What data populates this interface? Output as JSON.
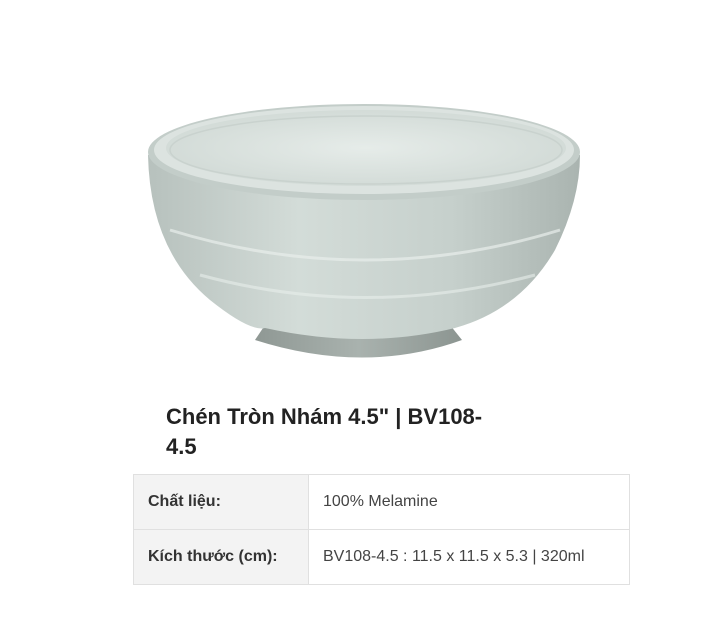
{
  "product": {
    "image_icon": "bowl-image",
    "title_line1": "Chén Tròn Nhám 4.5\" | BV108-",
    "title_line2": "4.5"
  },
  "specs": [
    {
      "label": "Chất liệu:",
      "value": "100% Melamine"
    },
    {
      "label": "Kích thước (cm):",
      "value": "BV108-4.5 : 11.5 x 11.5 x 5.3 | 320ml"
    }
  ],
  "colors": {
    "bowl_body": "#c9d3cf",
    "bowl_inner": "#dfe6e2",
    "bowl_foot": "#9aa39f",
    "table_label_bg": "#f3f3f3",
    "table_border": "#e0e0e0"
  }
}
